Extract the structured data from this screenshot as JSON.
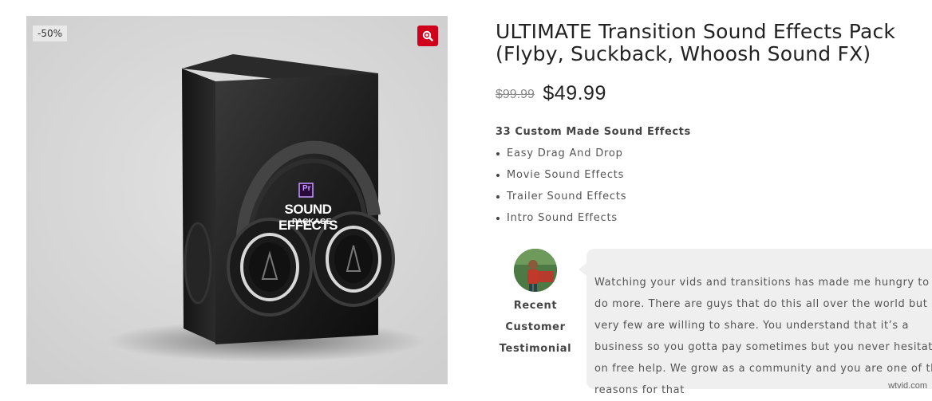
{
  "gallery": {
    "sale_badge": "-50%",
    "package": {
      "logo_text": "Pr",
      "title": "SOUND EFFECTS",
      "subtitle": "PACKAGE"
    }
  },
  "product": {
    "title_line1": "ULTIMATE Transition Sound Effects Pack",
    "title_line2": "(Flyby, Suckback, Whoosh Sound FX)",
    "price_old": "$99.99",
    "price_new": "$49.99",
    "features_heading": "33 Custom Made Sound Effects",
    "features": [
      "Easy Drag And Drop",
      "Movie Sound Effects",
      "Trailer Sound Effects",
      "Intro Sound Effects"
    ]
  },
  "testimonial": {
    "label_lines": [
      "Recent",
      "Customer",
      "Testimonial"
    ],
    "quote": "Watching your vids and transitions has made me hungry to do more. There are guys that do this all over the world but very few are willing to share. You understand that it’s a business so you gotta pay sometimes but you never hesitate on free help. We grow as a community and you are one of the reasons for that"
  },
  "watermark": "wtvid.com",
  "colors": {
    "accent": "#d0021b",
    "gallery_bg": "#d9d9d9",
    "bubble_bg": "#efefef"
  }
}
